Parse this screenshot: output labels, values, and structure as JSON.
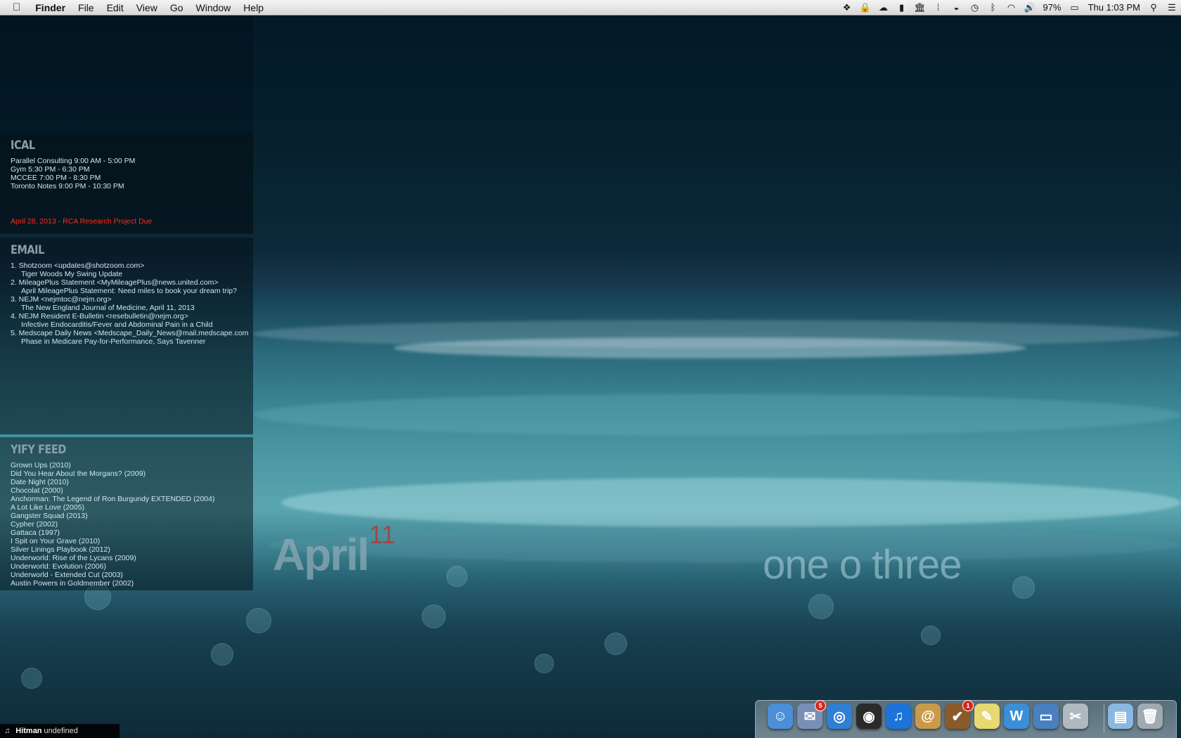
{
  "menubar": {
    "app_name": "Finder",
    "menus": [
      "File",
      "Edit",
      "View",
      "Go",
      "Window",
      "Help"
    ],
    "status_icons": [
      "dropbox-icon",
      "lock-icon",
      "cloud-icon",
      "bookmark-icon",
      "bank-icon",
      "grid-icon",
      "eye-icon",
      "time-machine-icon",
      "bluetooth-icon",
      "wifi-icon",
      "volume-icon"
    ],
    "battery": "97%",
    "clock": "Thu 1:03 PM"
  },
  "ical": {
    "title": "ICAL",
    "events": [
      "Parallel Consulting 9:00 AM - 5:00 PM",
      "Gym 5:30 PM - 6:30 PM",
      "MCCEE 7:00 PM - 8:30 PM",
      "Toronto Notes 9:00 PM - 10:30 PM"
    ],
    "deadline": "April 28, 2013 - RCA Research Project Due"
  },
  "email": {
    "title": "EMAIL",
    "messages": [
      {
        "from": "1. Shotzoom <updates@shotzoom.com>",
        "subject": "Tiger Woods My Swing Update"
      },
      {
        "from": "2. MileagePlus Statement <MyMileagePlus@news.united.com>",
        "subject": "April MileagePlus Statement: Need miles to book your dream trip?"
      },
      {
        "from": "3. NEJM <nejmtoc@nejm.org>",
        "subject": "The New England Journal of Medicine, April 11, 2013"
      },
      {
        "from": "4. NEJM Resident E-Bulletin <resebulletin@nejm.org>",
        "subject": "Infective Endocarditis/Fever and Abdominal Pain in a Child"
      },
      {
        "from": "5. Medscape Daily News <Medscape_Daily_News@mail.medscape.com",
        "subject": "Phase in Medicare Pay-for-Performance, Says Tavenner"
      }
    ]
  },
  "yify": {
    "title": "YIFY FEED",
    "items": [
      "Grown Ups (2010)",
      "Did You Hear About the Morgans? (2009)",
      "Date Night (2010)",
      "Chocolat (2000)",
      "Anchorman: The Legend of Ron Burgundy EXTENDED (2004)",
      "A Lot Like Love (2005)",
      "Gangster Squad (2013)",
      "Cypher (2002)",
      "Gattaca (1997)",
      "I Spit on Your Grave (2010)",
      "Silver Linings Playbook (2012)",
      "Underworld: Rise of the Lycans (2009)",
      "Underworld: Evolution (2006)",
      "Underworld - Extended Cut (2003)",
      "Austin Powers in Goldmember (2002)"
    ]
  },
  "overlay": {
    "month": "April",
    "day": "11",
    "time_words": "one o three"
  },
  "nowplaying": {
    "artist": "Hitman",
    "track": "undefined"
  },
  "dock": {
    "items": [
      {
        "name": "finder",
        "color": "#4a8fd8",
        "glyph": "☺"
      },
      {
        "name": "mail-stamp",
        "color": "#7a8fb5",
        "glyph": "✉",
        "badge": "5"
      },
      {
        "name": "safari",
        "color": "#2f7fd4",
        "glyph": "◎"
      },
      {
        "name": "camera",
        "color": "#2a2a2a",
        "glyph": "◉"
      },
      {
        "name": "itunes",
        "color": "#1e73d8",
        "glyph": "♫"
      },
      {
        "name": "address-book",
        "color": "#c99a4a",
        "glyph": "@"
      },
      {
        "name": "omnifocus",
        "color": "#8a5a2a",
        "glyph": "✔",
        "badge": "1"
      },
      {
        "name": "stickies",
        "color": "#e8d870",
        "glyph": "✎"
      },
      {
        "name": "word",
        "color": "#3a8fd6",
        "glyph": "W"
      },
      {
        "name": "display",
        "color": "#4a7fc0",
        "glyph": "▭"
      },
      {
        "name": "preview",
        "color": "#b0b8c0",
        "glyph": "✂"
      },
      {
        "name": "folder",
        "color": "#8ab8e0",
        "glyph": "▤"
      },
      {
        "name": "trash",
        "color": "#a0aab2",
        "glyph": "🗑"
      }
    ]
  }
}
